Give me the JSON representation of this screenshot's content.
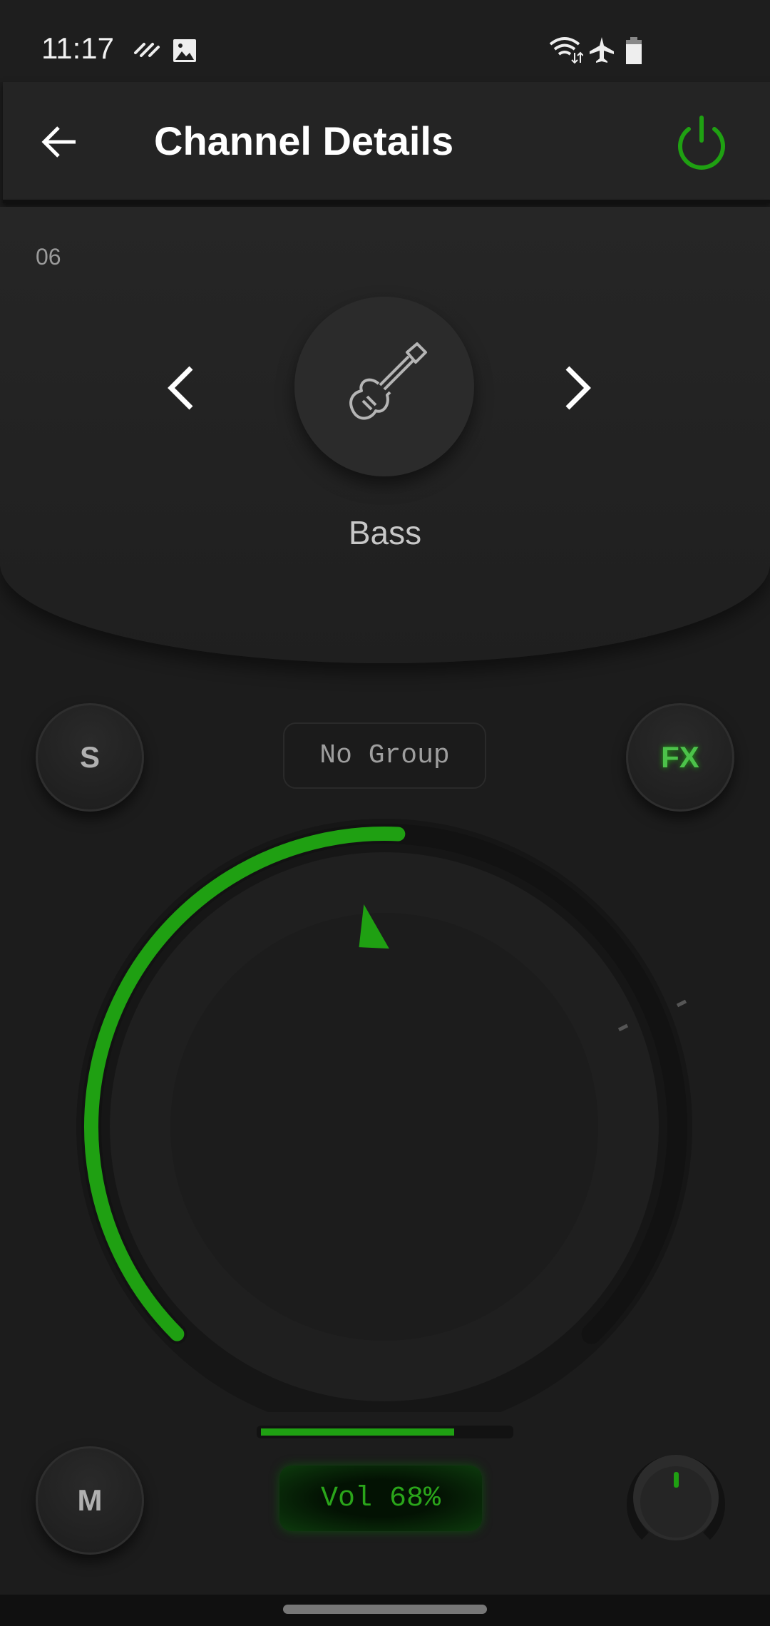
{
  "status_bar": {
    "time": "11:17",
    "icons": [
      "link-icon",
      "image-icon",
      "wifi-icon",
      "airplane-icon",
      "battery-icon"
    ]
  },
  "header": {
    "title": "Channel Details",
    "back_icon": "arrow-left-icon",
    "power_icon": "power-icon"
  },
  "channel": {
    "number": "06",
    "name": "Bass",
    "instrument_icon": "guitar-icon",
    "prev_icon": "chevron-left-icon",
    "next_icon": "chevron-right-icon"
  },
  "controls": {
    "solo_label": "S",
    "group_label": "No Group",
    "fx_label": "FX",
    "mute_label": "M",
    "volume_label": "Vol 68%"
  },
  "gain_knob_level": 0.51,
  "level_meter": 0.78,
  "colors": {
    "accent": "#1fa012",
    "fx": "#4cc24a",
    "background": "#1c1c1c"
  }
}
